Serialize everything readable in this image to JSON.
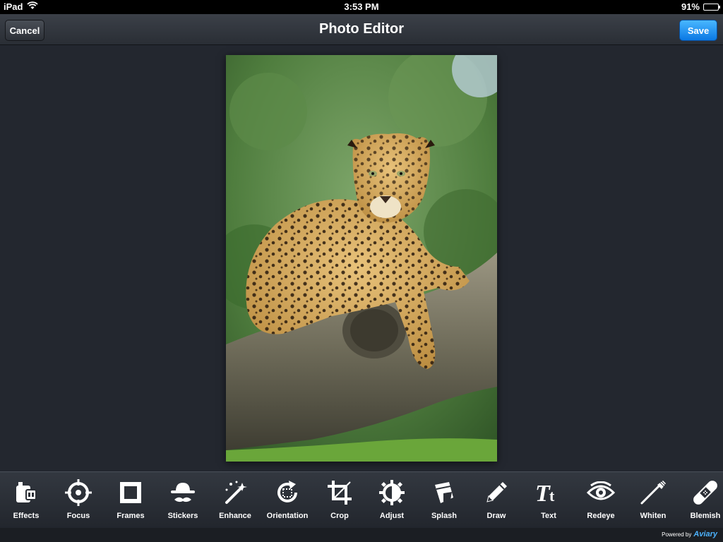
{
  "status_bar": {
    "device": "iPad",
    "time": "3:53 PM",
    "battery_percent": "91%",
    "battery_level": 0.91
  },
  "nav": {
    "title": "Photo Editor",
    "cancel_label": "Cancel",
    "save_label": "Save"
  },
  "tools": [
    {
      "label": "Effects",
      "icon": "effects-icon"
    },
    {
      "label": "Focus",
      "icon": "focus-icon"
    },
    {
      "label": "Frames",
      "icon": "frames-icon"
    },
    {
      "label": "Stickers",
      "icon": "stickers-icon"
    },
    {
      "label": "Enhance",
      "icon": "enhance-icon"
    },
    {
      "label": "Orientation",
      "icon": "orientation-icon"
    },
    {
      "label": "Crop",
      "icon": "crop-icon"
    },
    {
      "label": "Adjust",
      "icon": "adjust-icon"
    },
    {
      "label": "Splash",
      "icon": "splash-icon"
    },
    {
      "label": "Draw",
      "icon": "draw-icon"
    },
    {
      "label": "Text",
      "icon": "text-icon"
    },
    {
      "label": "Redeye",
      "icon": "redeye-icon"
    },
    {
      "label": "Whiten",
      "icon": "whiten-icon"
    },
    {
      "label": "Blemish",
      "icon": "blemish-icon"
    }
  ],
  "footer": {
    "powered_by": "Powered by",
    "brand": "Aviary"
  }
}
